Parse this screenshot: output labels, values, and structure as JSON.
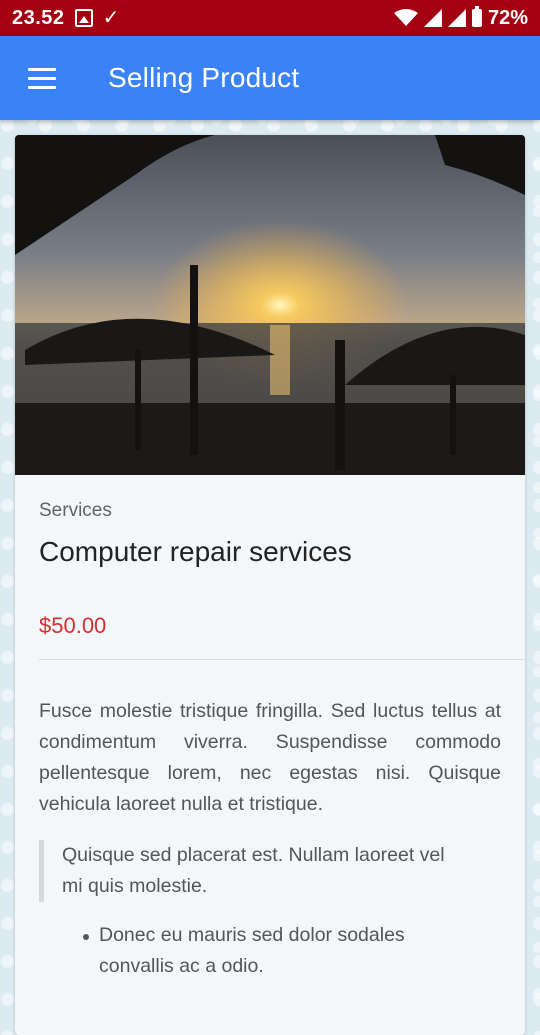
{
  "status_bar": {
    "time": "23.52",
    "battery": "72%",
    "icons": [
      "gallery-icon",
      "download-done-icon",
      "wifi-icon",
      "signal-icon",
      "signal-icon",
      "battery-icon"
    ]
  },
  "app_bar": {
    "title": "Selling Product",
    "menu_icon": "hamburger-menu-icon",
    "color": "#3b82f6"
  },
  "product": {
    "category": "Services",
    "title": "Computer repair services",
    "price": "$50.00",
    "price_color": "#d32f2f",
    "description": "Fusce molestie tristique fringilla. Sed luctus tellus at condimentum viverra. Suspendisse commodo pellentesque lorem, nec egestas nisi. Quisque vehicula laoreet nulla et tristique.",
    "quote": "Quisque sed placerat est. Nullam laoreet vel mi quis molestie.",
    "bullets": [
      "Donec eu mauris sed dolor sodales convallis ac a odio."
    ]
  }
}
